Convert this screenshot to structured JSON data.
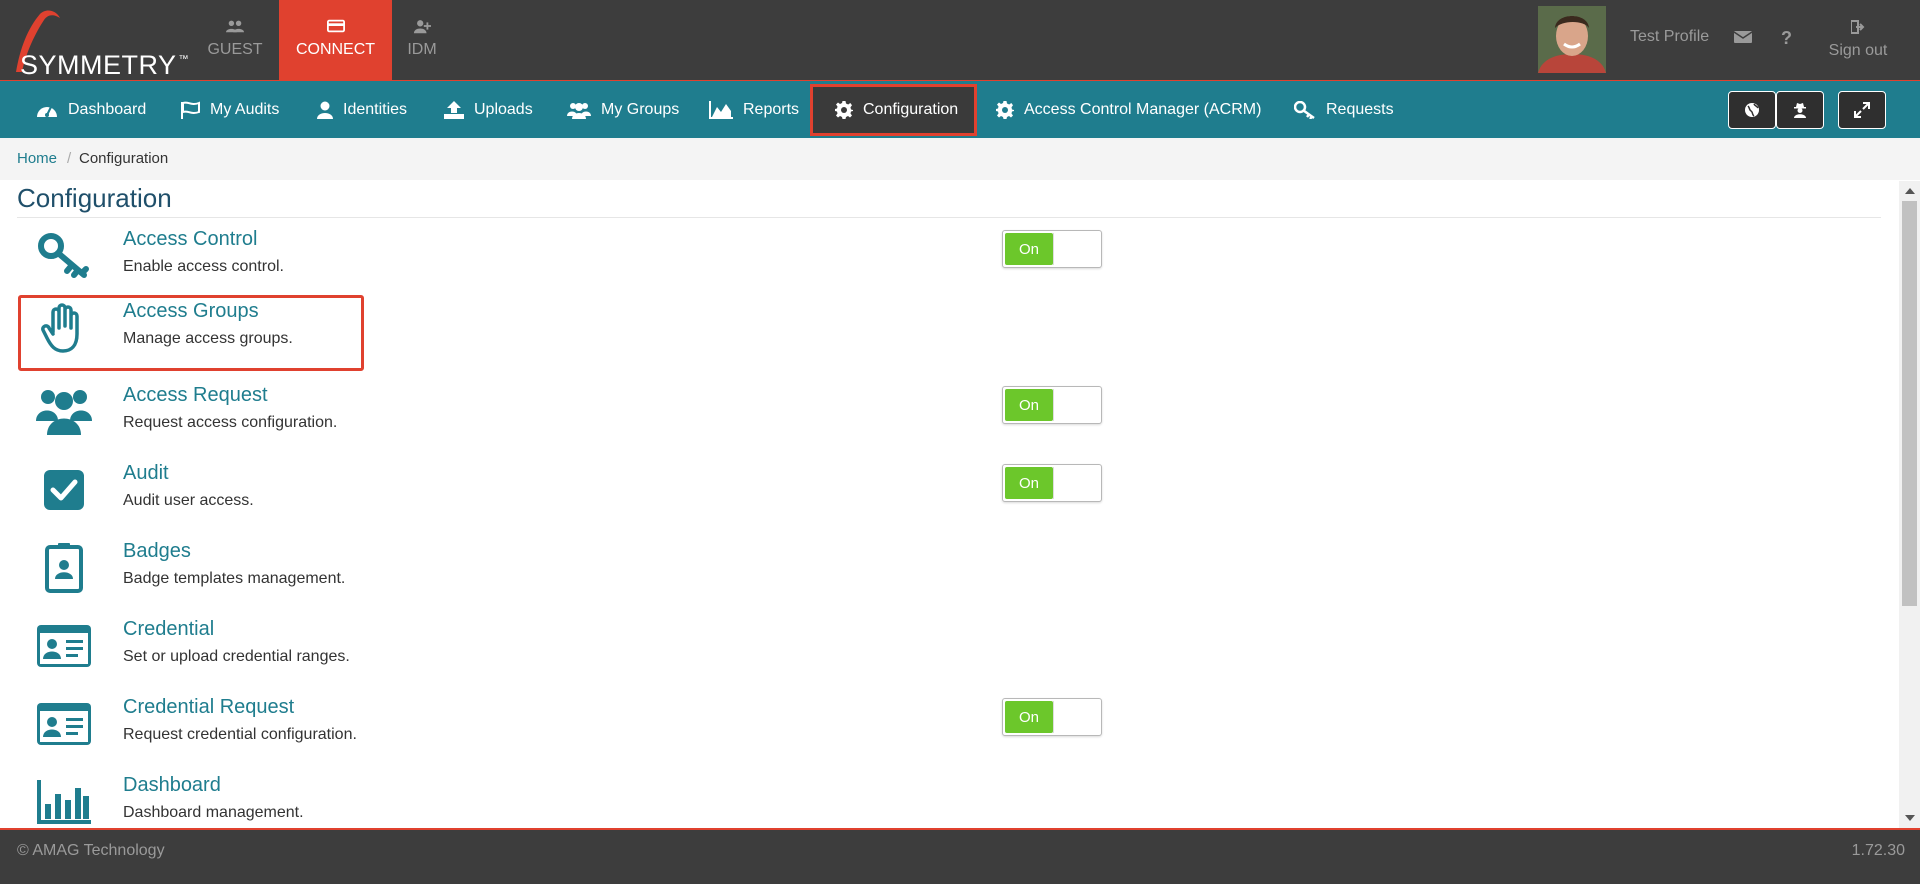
{
  "header": {
    "logo_text": "SYMMETRY",
    "logo_tm": "™",
    "app_tabs": [
      {
        "label": "GUEST",
        "icon": "users-icon"
      },
      {
        "label": "CONNECT",
        "icon": "card-icon",
        "active": true
      },
      {
        "label": "IDM",
        "icon": "user-plus-icon"
      }
    ],
    "profile_name": "Test Profile",
    "help": "?",
    "signout_label": "Sign out"
  },
  "nav": {
    "items": [
      {
        "label": "Dashboard",
        "icon": "dashboard-icon"
      },
      {
        "label": "My Audits",
        "icon": "flag-icon"
      },
      {
        "label": "Identities",
        "icon": "user-icon"
      },
      {
        "label": "Uploads",
        "icon": "upload-icon"
      },
      {
        "label": "My Groups",
        "icon": "users-icon"
      },
      {
        "label": "Reports",
        "icon": "area-chart-icon"
      },
      {
        "label": "Configuration",
        "icon": "gear-icon",
        "active": true
      },
      {
        "label": "Access Control Manager (ACRM)",
        "icon": "gear-icon"
      },
      {
        "label": "Requests",
        "icon": "key-icon"
      }
    ],
    "right_buttons": [
      "globe-icon",
      "user-secret-icon",
      "expand-icon"
    ]
  },
  "breadcrumb": {
    "home": "Home",
    "separator": "/",
    "current": "Configuration"
  },
  "page_title": "Configuration",
  "config_items": [
    {
      "title": "Access Control",
      "desc": "Enable access control.",
      "icon": "key-icon",
      "toggle": "On"
    },
    {
      "title": "Access Groups",
      "desc": "Manage access groups.",
      "icon": "hand-icon",
      "highlighted": true
    },
    {
      "title": "Access Request",
      "desc": "Request access configuration.",
      "icon": "users-icon",
      "toggle": "On"
    },
    {
      "title": "Audit",
      "desc": "Audit user access.",
      "icon": "checkbox-icon",
      "toggle": "On"
    },
    {
      "title": "Badges",
      "desc": "Badge templates management.",
      "icon": "badge-icon"
    },
    {
      "title": "Credential",
      "desc": "Set or upload credential ranges.",
      "icon": "id-card-icon"
    },
    {
      "title": "Credential Request",
      "desc": "Request credential configuration.",
      "icon": "id-card-icon",
      "toggle": "On"
    },
    {
      "title": "Dashboard",
      "desc": "Dashboard management.",
      "icon": "bar-chart-icon"
    }
  ],
  "footer": {
    "copyright": "© AMAG Technology",
    "version": "1.72.30"
  },
  "colors": {
    "teal": "#1f7d8e",
    "header_bg": "#3d3d3d",
    "accent_red": "#e0412f",
    "toggle_green": "#6cc72b"
  }
}
